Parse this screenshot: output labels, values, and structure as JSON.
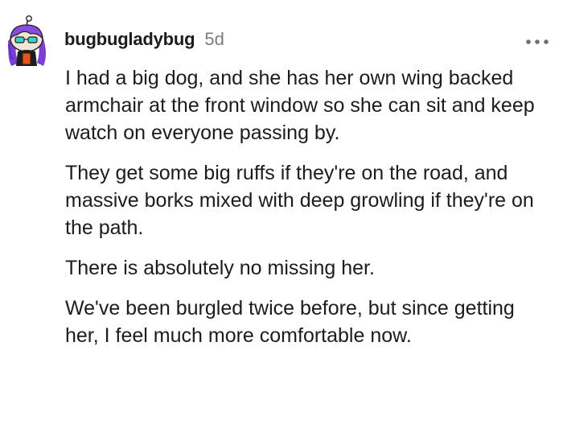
{
  "comment": {
    "author": "bugbugladybug",
    "age": "5d",
    "more_icon": "more-horizontal-icon",
    "avatar_icon": "snoo-avatar-icon",
    "paragraphs": [
      "I had a big dog, and she has her own wing backed armchair at the front window so she can sit and keep watch on everyone passing by.",
      "They get some big ruffs if they're on the road, and massive borks mixed with deep growling if they're on the path.",
      "There is absolutely no missing her.",
      "We've been burgled twice before, but since getting her, I feel much more comfortable now."
    ]
  },
  "colors": {
    "text": "#1c1c1c",
    "meta": "#7c7c7c",
    "avatar_hair": "#7b3fd6",
    "avatar_shirt": "#e8541c"
  }
}
